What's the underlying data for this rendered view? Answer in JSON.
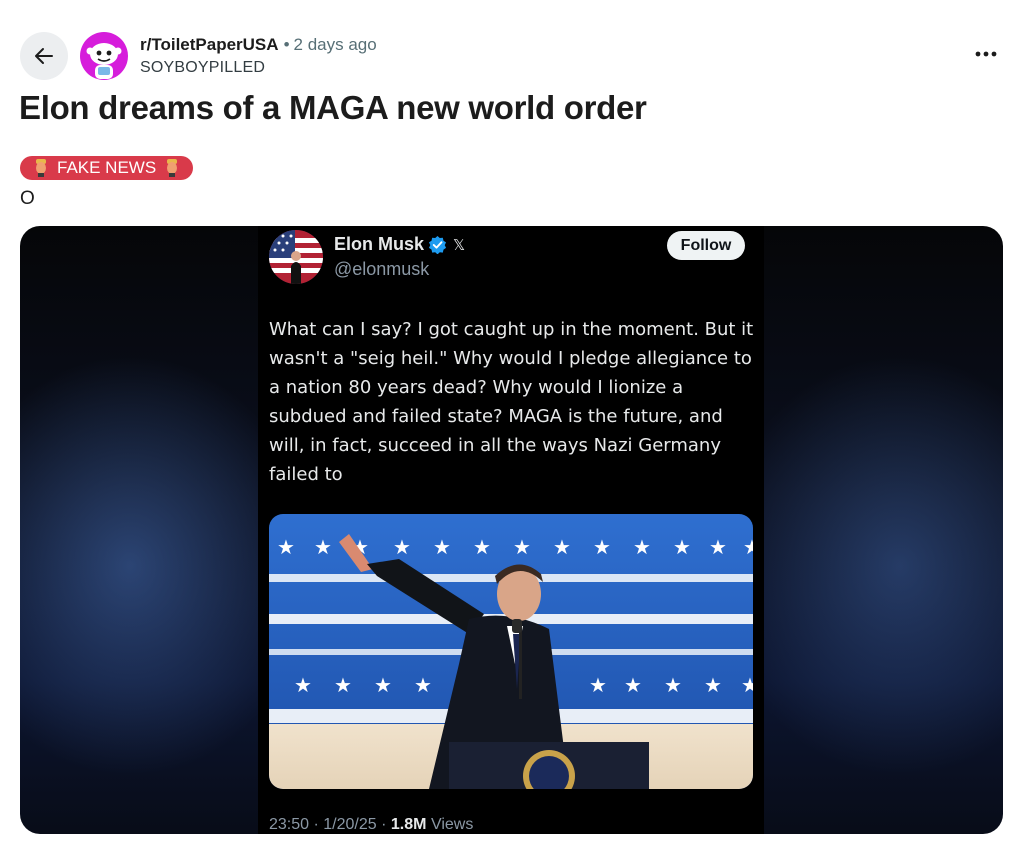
{
  "post": {
    "subreddit": "r/ToiletPaperUSA",
    "separator": "•",
    "time_ago": "2 days ago",
    "author": "SOYBOYPILLED",
    "title": "Elon dreams of a MAGA new world order",
    "flair": "FAKE NEWS",
    "body": "O"
  },
  "tweet": {
    "name": "Elon Musk",
    "handle": "@elonmusk",
    "follow_label": "Follow",
    "x_badge": "𝕏",
    "text": "What can I say? I got caught up in the moment. But it wasn't a \"seig heil.\" Why would I pledge allegiance to a nation 80 years dead? Why would I lionize a subdued and failed state? MAGA is the future, and will, in fact, succeed in all the ways Nazi Germany failed to",
    "time": "23:50",
    "date": "1/20/25",
    "views_count": "1.8M",
    "views_label": "Views",
    "dot": "·"
  },
  "icons": {
    "back": "arrow-left-icon",
    "more": "more-horizontal-icon",
    "verified": "verified-check-icon"
  },
  "colors": {
    "flair_bg": "#d93a4a",
    "subreddit_avatar_bg": "#d61ddb",
    "verified_blue": "#1d9bf0",
    "tweet_bg": "#000000"
  }
}
